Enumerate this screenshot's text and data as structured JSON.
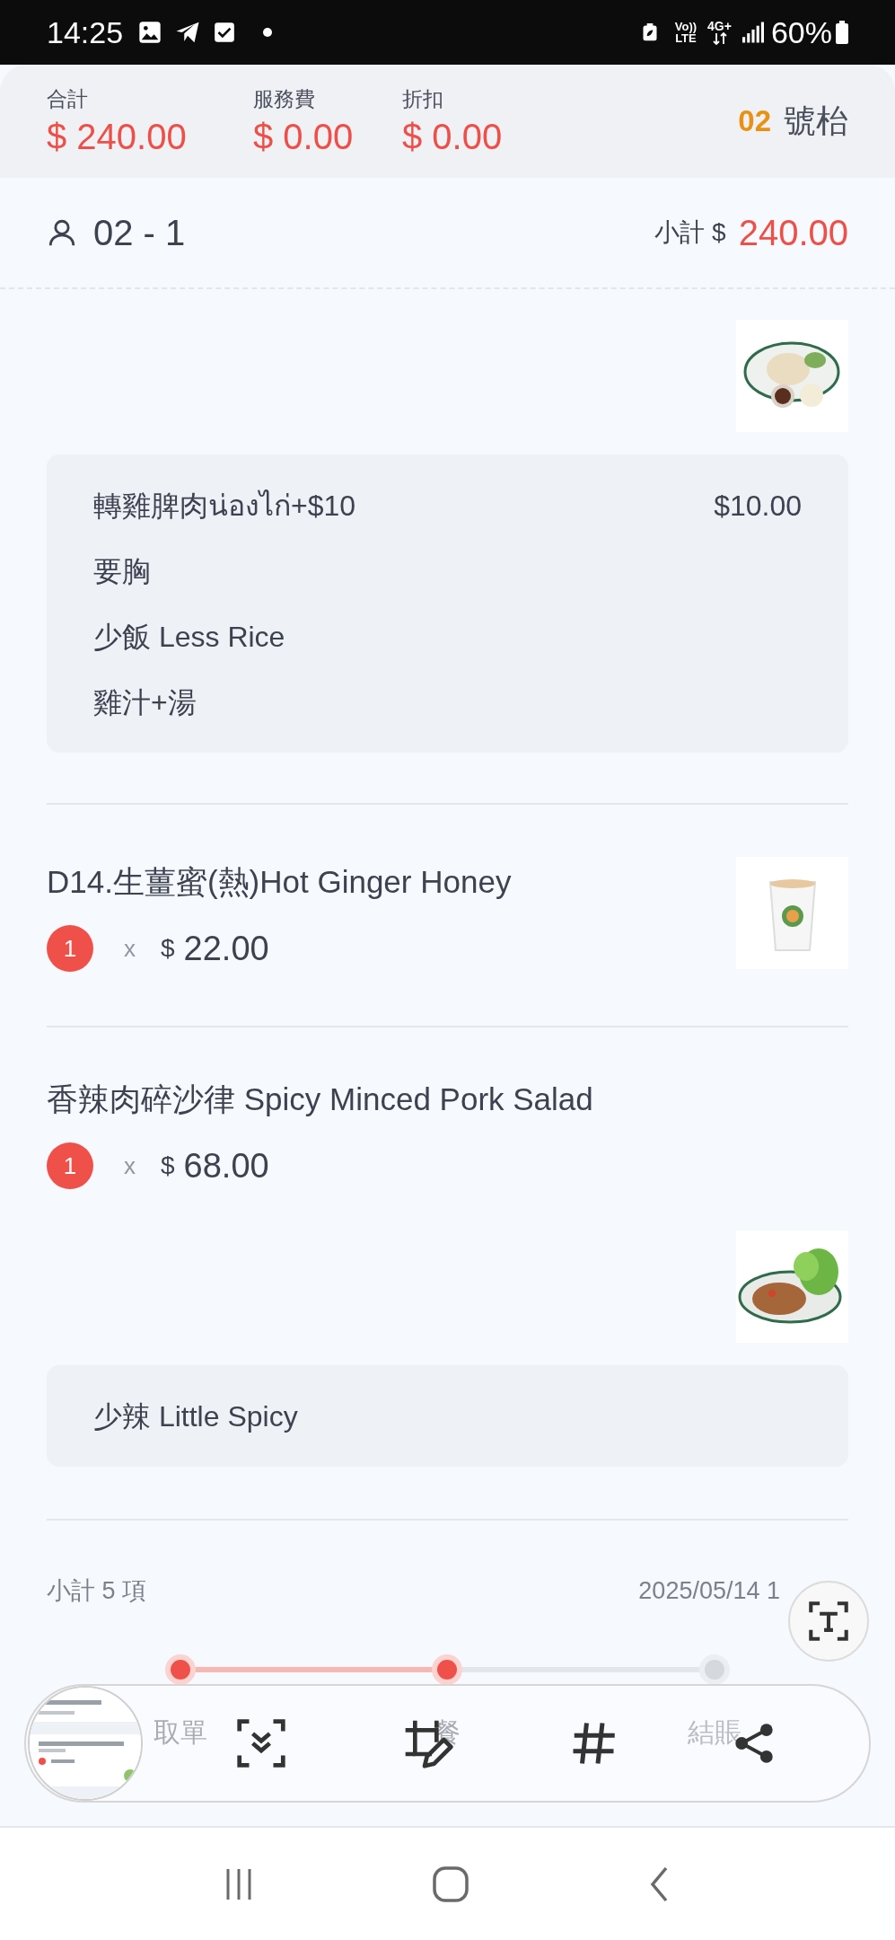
{
  "status_bar": {
    "time": "14:25",
    "volte_label": "Vo))",
    "lte_label": "LTE",
    "network_label": "4G+",
    "battery": "60%"
  },
  "summary": [
    {
      "label": "合計",
      "value": "$ 240.00"
    },
    {
      "label": "服務費",
      "value": "$ 0.00"
    },
    {
      "label": "折扣",
      "value": "$ 0.00"
    }
  ],
  "table": {
    "number": "02",
    "label": "號枱"
  },
  "seat": {
    "name": "02 - 1",
    "subtotal_label": "小計 $",
    "subtotal": "240.00"
  },
  "items": [
    {
      "kind": "stacked",
      "modifiers": [
        {
          "text": "轉雞脾肉น่องไก่+$10",
          "price": "$10.00"
        },
        {
          "text": "要胸"
        },
        {
          "text": "少飯 Less Rice"
        },
        {
          "text": "雞汁+湯"
        }
      ]
    },
    {
      "kind": "side",
      "title": "D14.生薑蜜(熱)Hot Ginger Honey",
      "quantity": "1",
      "times": "x",
      "currency": "$",
      "price": "22.00"
    },
    {
      "kind": "stacked",
      "title": "香辣肉碎沙律 Spicy Minced Pork Salad",
      "quantity": "1",
      "times": "x",
      "currency": "$",
      "price": "68.00",
      "modifiers": [
        {
          "text": "少辣 Little Spicy"
        }
      ]
    }
  ],
  "footer": {
    "count": "小計 5 項",
    "date": "2025/05/14 1"
  },
  "steps": [
    {
      "label": "取單",
      "done": true
    },
    {
      "label": "餐",
      "done": true
    },
    {
      "label": "結賬",
      "done": false
    }
  ]
}
